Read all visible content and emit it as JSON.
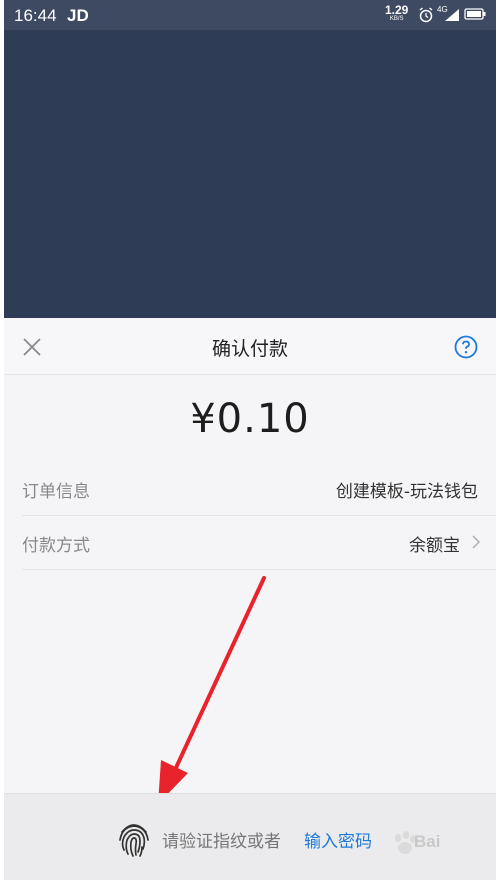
{
  "status_bar": {
    "time": "16:44",
    "carrier": "JD",
    "speed_value": "1.29",
    "speed_unit": "KB/S",
    "network_badge": "4G"
  },
  "sheet": {
    "title": "确认付款",
    "amount": "¥0.10",
    "rows": [
      {
        "label": "订单信息",
        "value": "创建模板-玩法钱包"
      },
      {
        "label": "付款方式",
        "value": "余额宝"
      }
    ],
    "footer": {
      "prompt": "请验证指纹或者",
      "password_link": "输入密码"
    }
  },
  "watermark": {
    "text": "Bai"
  },
  "colors": {
    "status_bar": "#3d4a62",
    "overlay": "#2f3c55",
    "link": "#1e7ad6",
    "arrow": "#e8232b"
  },
  "icons": [
    "close-icon",
    "help-icon",
    "chevron-right-icon",
    "fingerprint-icon",
    "alarm-icon",
    "signal-icon",
    "battery-icon"
  ]
}
